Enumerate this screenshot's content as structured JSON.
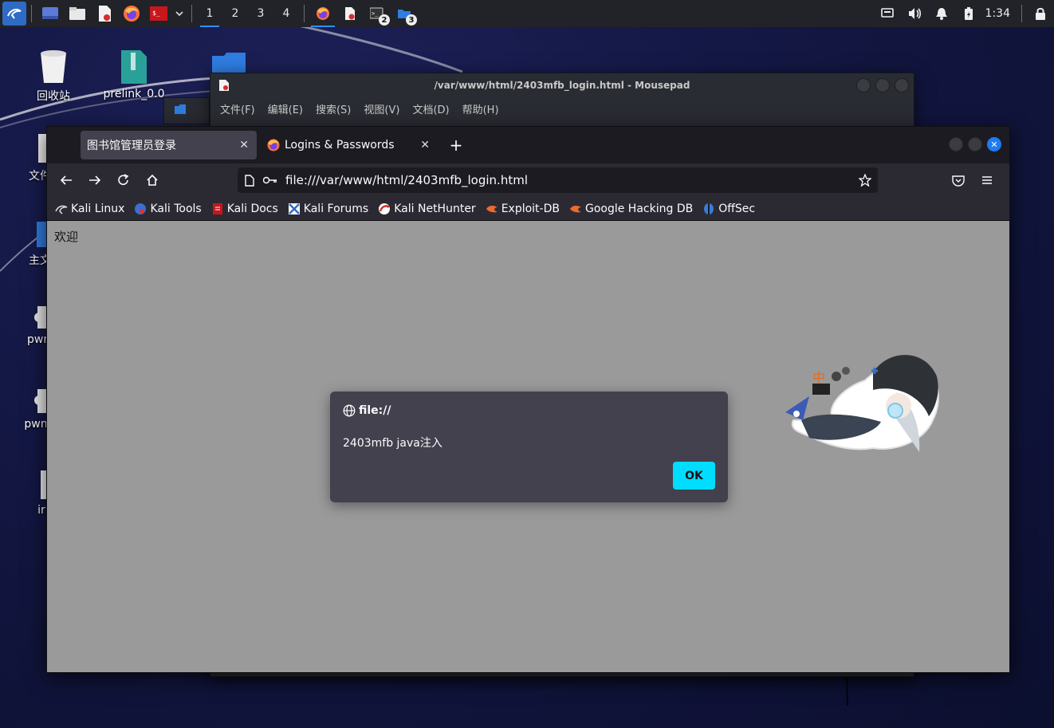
{
  "panel": {
    "workspaces": [
      "1",
      "2",
      "3",
      "4"
    ],
    "active_workspace": "1",
    "task_badges": [
      "2",
      "3"
    ],
    "clock": "1:34",
    "icons": [
      "kali-menu-icon",
      "desktop-icon",
      "file-manager-icon",
      "text-editor-icon",
      "firefox-icon",
      "terminal-icon"
    ]
  },
  "desktop": {
    "icons": [
      {
        "label": "回收站"
      },
      {
        "label": "prelink_0.0"
      },
      {
        "label": "文件"
      },
      {
        "label": "主文"
      },
      {
        "label": "pwn"
      },
      {
        "label": "pwn"
      },
      {
        "label": "ir"
      }
    ]
  },
  "mousepad": {
    "title": "/var/www/html/2403mfb_login.html - Mousepad",
    "menu": [
      "文件(F)",
      "编辑(E)",
      "搜索(S)",
      "视图(V)",
      "文档(D)",
      "帮助(H)"
    ]
  },
  "firefox": {
    "tabs": [
      {
        "label": "图书馆管理员登录",
        "active": true
      },
      {
        "label": "Logins & Passwords",
        "active": false
      }
    ],
    "url": "file:///var/www/html/2403mfb_login.html",
    "bookmarks": [
      "Kali Linux",
      "Kali Tools",
      "Kali Docs",
      "Kali Forums",
      "Kali NetHunter",
      "Exploit-DB",
      "Google Hacking DB",
      "OffSec"
    ],
    "page": {
      "text": "欢迎"
    },
    "dialog": {
      "origin": "file://",
      "message": "2403mfb java注入",
      "ok_label": "OK"
    }
  },
  "colors": {
    "accent": "#00ddff",
    "tab_active": "#42414d",
    "page_bg": "#9a9a9b",
    "panel_bg": "#212329"
  }
}
